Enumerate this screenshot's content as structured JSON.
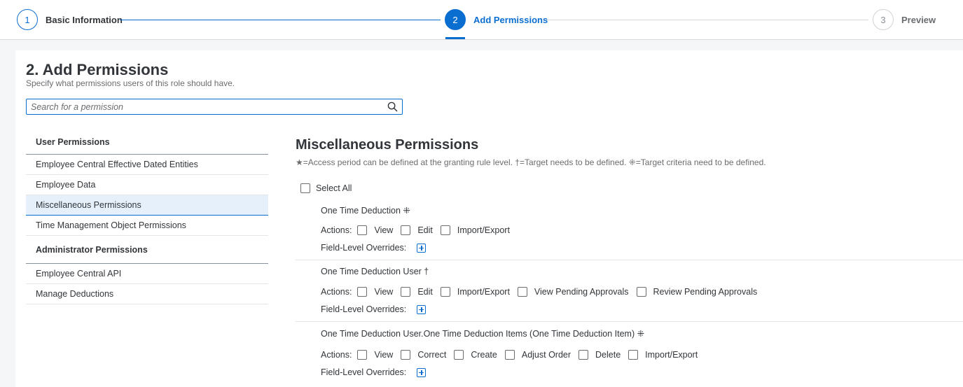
{
  "wizard": {
    "steps": [
      {
        "number": "1",
        "label": "Basic Information"
      },
      {
        "number": "2",
        "label": "Add Permissions"
      },
      {
        "number": "3",
        "label": "Preview"
      }
    ],
    "active_step": 2
  },
  "page": {
    "title": "2. Add Permissions",
    "subtitle": "Specify what permissions users of this role should have."
  },
  "search": {
    "placeholder": "Search for a permission",
    "value": ""
  },
  "nav": {
    "groups": [
      {
        "label": "User Permissions",
        "items": [
          "Employee Central Effective Dated Entities",
          "Employee Data",
          "Miscellaneous Permissions",
          "Time Management Object Permissions"
        ]
      },
      {
        "label": "Administrator Permissions",
        "items": [
          "Employee Central API",
          "Manage Deductions"
        ]
      }
    ],
    "selected": "Miscellaneous Permissions"
  },
  "section": {
    "title": "Miscellaneous Permissions",
    "legend": "★=Access period can be defined at the granting rule level.   †=Target needs to be defined.   ⁜=Target criteria need to be defined.",
    "select_all_label": "Select All",
    "actions_label": "Actions:",
    "overrides_label": "Field-Level Overrides:"
  },
  "permissions": [
    {
      "title": "One Time Deduction ⁜",
      "actions": [
        "View",
        "Edit",
        "Import/Export"
      ]
    },
    {
      "title": "One Time Deduction User †",
      "actions": [
        "View",
        "Edit",
        "Import/Export",
        "View Pending Approvals",
        "Review Pending Approvals"
      ]
    },
    {
      "title": "One Time Deduction User.One Time Deduction Items (One Time Deduction Item) ⁜",
      "actions": [
        "View",
        "Correct",
        "Create",
        "Adjust Order",
        "Delete",
        "Import/Export"
      ]
    }
  ],
  "colors": {
    "accent": "#0a6ed1",
    "selected_bg": "#e5f0fa",
    "text": "#32363a",
    "muted": "#6a6d70"
  }
}
